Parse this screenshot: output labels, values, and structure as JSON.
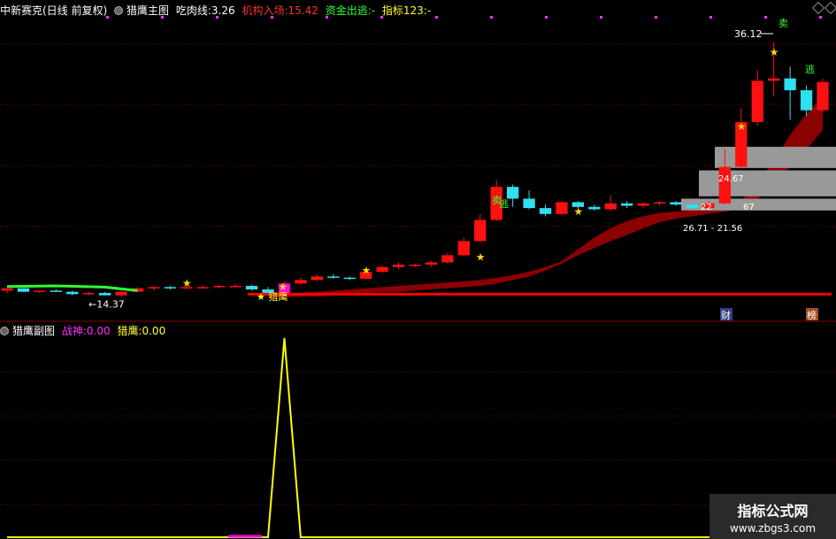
{
  "header_main": {
    "stock": "中新赛克(日线 前复权)",
    "indicator": "猎鹰主图",
    "eat_label": "吃肉线:",
    "eat_value": "3.26",
    "inst_label": "机构入场:",
    "inst_value": "15.42",
    "outflow_label": "资金出逃:",
    "outflow_value": "-",
    "idx_label": "指标123:",
    "idx_value": "-"
  },
  "header_sub": {
    "indicator": "猎鹰副图",
    "war_label": "战神:",
    "war_value": "0.00",
    "hawk_label": "猎鹰:",
    "hawk_value": "0.00"
  },
  "labels": {
    "hawk_signal": "猎鹰",
    "high_price": "36.12",
    "low_price": "14.37",
    "range_a": "24.67",
    "range_b": "22",
    "range_c": "26.71 - 21.56",
    "range_d": "67",
    "sell_tag": "卖",
    "escape_tag": "逃",
    "fin_tag": "财",
    "rank_tag": "榜"
  },
  "watermark": {
    "title": "指标公式网",
    "url": "www.zbgs3.com"
  },
  "colors": {
    "up": "#ff1010",
    "down": "#30e0f0",
    "band": "#8b0000",
    "signal_line": "#ff0000",
    "sub_line": "#ffff00",
    "grid": "#8b0000"
  },
  "chart_data": [
    {
      "type": "candlestick",
      "ylim": [
        13,
        38
      ],
      "candles": [
        [
          15.0,
          15.2,
          14.8,
          15.2
        ],
        [
          15.2,
          15.2,
          14.9,
          14.9
        ],
        [
          14.9,
          15.0,
          14.8,
          15.0
        ],
        [
          15.0,
          15.1,
          14.9,
          14.9
        ],
        [
          14.9,
          15.0,
          14.6,
          14.7
        ],
        [
          14.7,
          14.9,
          14.6,
          14.8
        ],
        [
          14.8,
          14.9,
          14.6,
          14.6
        ],
        [
          14.6,
          15.0,
          14.5,
          14.9
        ],
        [
          14.9,
          15.3,
          14.9,
          15.2
        ],
        [
          15.2,
          15.4,
          15.0,
          15.3
        ],
        [
          15.3,
          15.4,
          15.1,
          15.2
        ],
        [
          15.2,
          15.4,
          15.1,
          15.3
        ],
        [
          15.3,
          15.5,
          15.2,
          15.3
        ],
        [
          15.3,
          15.5,
          15.2,
          15.4
        ],
        [
          15.4,
          15.6,
          15.3,
          15.4
        ],
        [
          15.4,
          15.5,
          15.0,
          15.1
        ],
        [
          15.1,
          15.3,
          14.8,
          14.8
        ],
        [
          14.8,
          15.8,
          14.8,
          15.6
        ],
        [
          15.6,
          16.1,
          15.5,
          15.9
        ],
        [
          15.9,
          16.4,
          15.8,
          16.2
        ],
        [
          16.2,
          16.4,
          16.0,
          16.1
        ],
        [
          16.1,
          16.2,
          15.9,
          16.0
        ],
        [
          16.0,
          16.7,
          16.0,
          16.6
        ],
        [
          16.6,
          17.1,
          16.5,
          17.0
        ],
        [
          17.0,
          17.4,
          16.8,
          17.2
        ],
        [
          17.2,
          17.3,
          17.0,
          17.2
        ],
        [
          17.2,
          17.5,
          17.0,
          17.4
        ],
        [
          17.4,
          18.2,
          17.3,
          18.0
        ],
        [
          18.0,
          19.5,
          17.9,
          19.2
        ],
        [
          19.2,
          21.5,
          19.1,
          21.0
        ],
        [
          21.0,
          24.4,
          20.9,
          23.8
        ],
        [
          23.8,
          24.0,
          22.1,
          22.8
        ],
        [
          22.8,
          23.5,
          21.9,
          22.0
        ],
        [
          22.0,
          22.3,
          21.3,
          21.5
        ],
        [
          21.5,
          22.6,
          21.4,
          22.5
        ],
        [
          22.5,
          22.6,
          22.0,
          22.1
        ],
        [
          22.1,
          22.3,
          21.8,
          21.9
        ],
        [
          21.9,
          23.1,
          21.8,
          22.4
        ],
        [
          22.4,
          22.6,
          22.0,
          22.2
        ],
        [
          22.2,
          22.5,
          22.0,
          22.4
        ],
        [
          22.4,
          22.6,
          22.2,
          22.5
        ],
        [
          22.5,
          22.6,
          22.2,
          22.3
        ],
        [
          22.3,
          22.4,
          21.9,
          22.0
        ],
        [
          22.0,
          22.6,
          21.9,
          22.4
        ],
        [
          22.4,
          27.0,
          22.3,
          25.5
        ],
        [
          25.5,
          30.5,
          25.4,
          29.3
        ],
        [
          29.3,
          33.7,
          29.0,
          32.8
        ],
        [
          32.8,
          36.1,
          31.5,
          33.0
        ],
        [
          33.0,
          34.0,
          29.5,
          32.0
        ],
        [
          32.0,
          32.4,
          29.8,
          30.3
        ],
        [
          30.3,
          33.0,
          30.1,
          32.7
        ]
      ],
      "band_upper": [
        14.6,
        14.7,
        14.8,
        14.9,
        15.0,
        15.1,
        15.2,
        15.3,
        15.4,
        15.5,
        15.6,
        15.7,
        15.8,
        15.9,
        16.1,
        16.3,
        16.6,
        17.0,
        17.5,
        18.5,
        19.5,
        20.3,
        20.9,
        21.3,
        21.6,
        21.7,
        21.8,
        21.9,
        22.0,
        22.6,
        24.2,
        26.0,
        28.2,
        30.0,
        31.5
      ],
      "band_lower": [
        14.4,
        14.4,
        14.5,
        14.5,
        14.6,
        14.7,
        14.8,
        14.9,
        14.9,
        15.0,
        15.1,
        15.2,
        15.3,
        15.4,
        15.6,
        15.9,
        16.2,
        16.7,
        17.3,
        18.0,
        18.6,
        19.2,
        19.7,
        20.3,
        20.8,
        21.1,
        21.3,
        21.5,
        21.7,
        22.0,
        22.8,
        24.0,
        25.5,
        27.0,
        28.6
      ],
      "band_start_index": 16,
      "hawk_signal_line": 14.7,
      "green_line": [
        [
          0,
          15.35
        ],
        [
          3,
          15.4
        ],
        [
          6,
          15.3
        ],
        [
          8,
          15.0
        ]
      ]
    },
    {
      "type": "line",
      "series": [
        {
          "values": [
            0,
            0,
            0,
            0,
            0,
            0,
            0,
            0,
            0,
            0,
            0,
            0,
            0,
            0,
            0,
            0,
            0,
            1,
            0,
            0,
            0,
            0,
            0,
            0,
            0,
            0,
            0,
            0,
            0,
            0,
            0,
            0,
            0,
            0,
            0,
            0,
            0,
            0,
            0,
            0,
            0,
            0,
            0,
            0,
            0,
            0,
            0,
            0,
            0,
            0,
            0
          ]
        }
      ],
      "ylim": [
        0,
        1
      ]
    }
  ]
}
